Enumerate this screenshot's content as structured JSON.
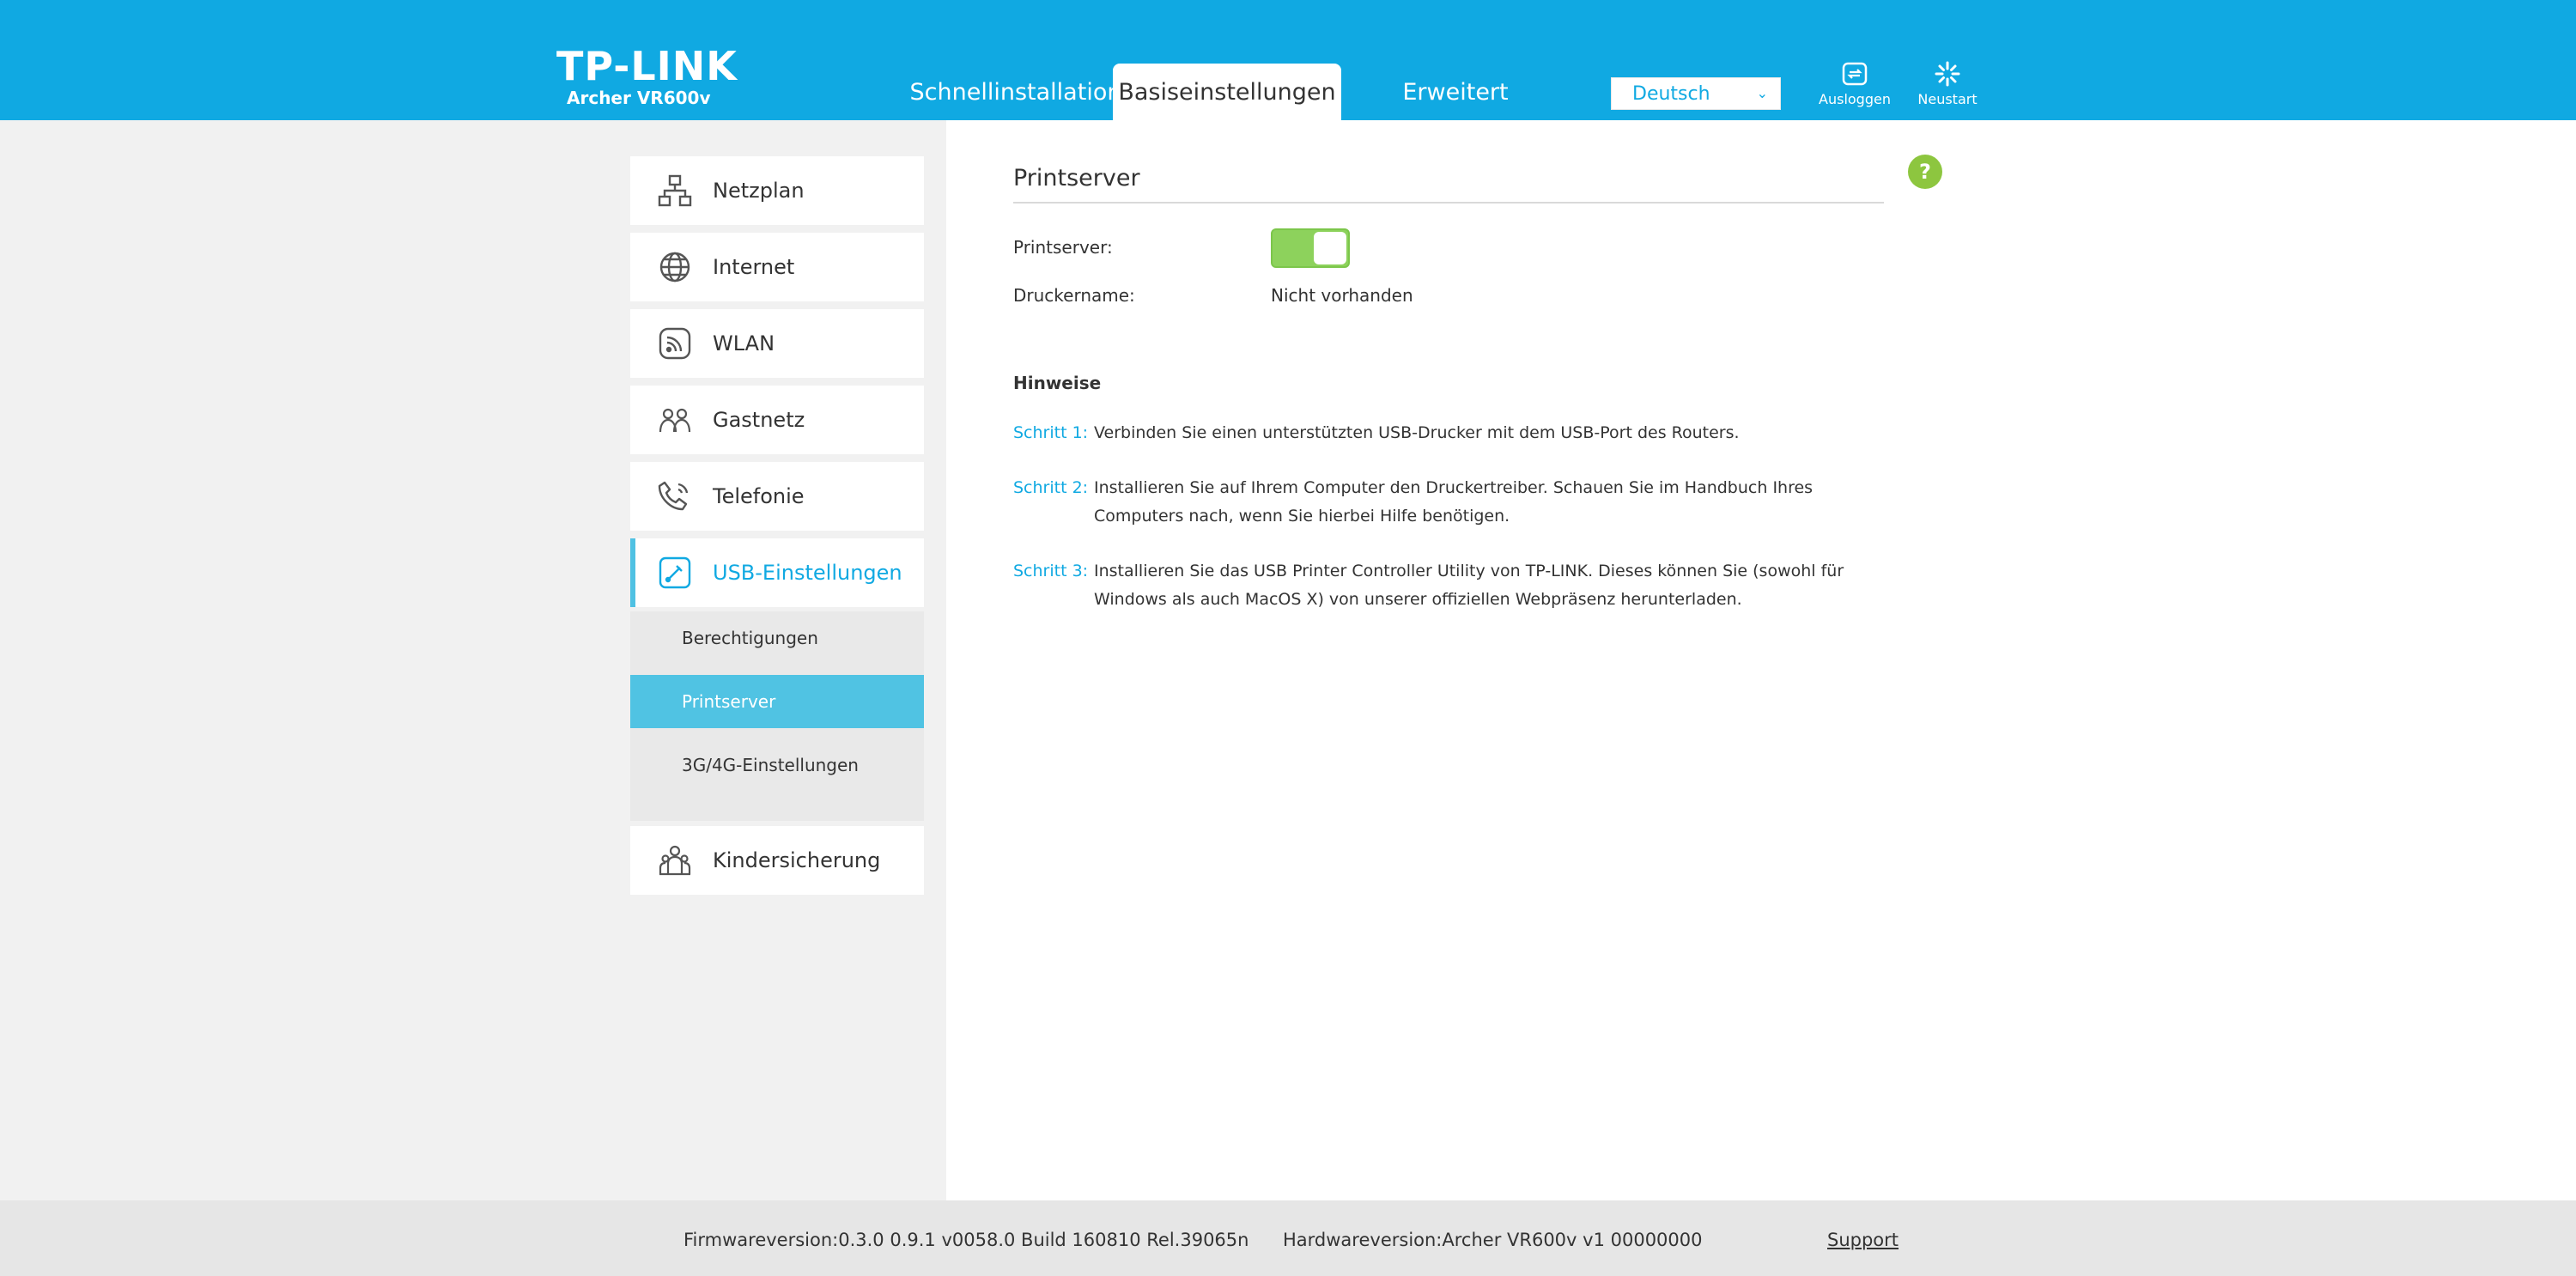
{
  "header": {
    "logo_text": "TP-LINK",
    "model": "Archer VR600v",
    "tabs": [
      {
        "label": "Schnellinstallation"
      },
      {
        "label": "Basiseinstellungen"
      },
      {
        "label": "Erweitert"
      }
    ],
    "language": "Deutsch",
    "logout_label": "Ausloggen",
    "reboot_label": "Neustart"
  },
  "sidebar": {
    "items": [
      {
        "label": "Netzplan",
        "icon": "network-map-icon"
      },
      {
        "label": "Internet",
        "icon": "globe-icon"
      },
      {
        "label": "WLAN",
        "icon": "wireless-icon"
      },
      {
        "label": "Gastnetz",
        "icon": "guest-network-icon"
      },
      {
        "label": "Telefonie",
        "icon": "phone-icon"
      },
      {
        "label": "USB-Einstellungen",
        "icon": "usb-settings-icon"
      },
      {
        "label": "Kindersicherung",
        "icon": "parental-control-icon"
      }
    ],
    "submenu": [
      {
        "label": "Berechtigungen"
      },
      {
        "label": "Printserver"
      },
      {
        "label": "3G/4G-Einstellungen"
      }
    ]
  },
  "main": {
    "title": "Printserver",
    "fields": {
      "printserver_label": "Printserver:",
      "printserver_enabled": true,
      "printer_name_label": "Druckername:",
      "printer_name_value": "Nicht vorhanden"
    },
    "notes_title": "Hinweise",
    "steps": [
      {
        "label": "Schritt 1:",
        "text": "Verbinden Sie einen unterstützten USB-Drucker mit dem USB-Port des Routers."
      },
      {
        "label": "Schritt 2:",
        "text": "Installieren Sie auf Ihrem Computer den Druckertreiber. Schauen Sie im Handbuch Ihres Computers nach, wenn Sie hierbei Hilfe benötigen."
      },
      {
        "label": "Schritt 3:",
        "text": "Installieren Sie das USB Printer Controller Utility von TP-LINK. Dieses können Sie (sowohl für Windows als auch MacOS X) von unserer offiziellen Webpräsenz herunterladen."
      }
    ]
  },
  "footer": {
    "firmware": "Firmwareversion:0.3.0 0.9.1 v0058.0 Build 160810 Rel.39065n",
    "hardware": "Hardwareversion:Archer VR600v v1 00000000",
    "support": "Support"
  },
  "colors": {
    "header_bg": "#10a9e2",
    "accent": "#10a9e2",
    "submenu_active": "#50c3e3",
    "toggle_on": "#8dd25c",
    "help_green": "#8dc63f"
  }
}
